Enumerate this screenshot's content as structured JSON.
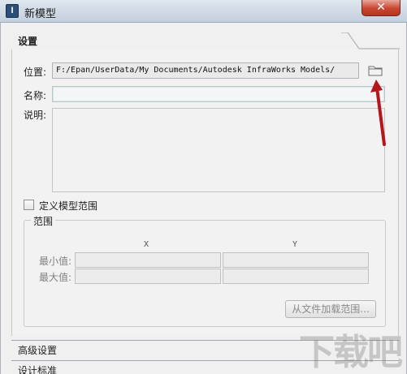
{
  "window": {
    "title": "新模型",
    "app_icon": "infraworks-icon",
    "close_label": "✕"
  },
  "settings": {
    "header": "设置",
    "location_label": "位置:",
    "location_value": "F:/Epan/UserData/My Documents/Autodesk InfraWorks Models/",
    "name_label": "名称:",
    "name_value": "",
    "description_label": "说明:",
    "description_value": "",
    "define_range_label": "定义模型范围",
    "define_range_checked": false
  },
  "range": {
    "legend": "范围",
    "col_x": "X",
    "col_y": "Y",
    "min_label": "最小值:",
    "max_label": "最大值:",
    "load_button": "从文件加载范围..."
  },
  "sections": {
    "advanced": "高级设置",
    "standards": "设计标准"
  },
  "annotation": {
    "arrow_color": "#b4161b"
  },
  "watermark": "下载吧"
}
